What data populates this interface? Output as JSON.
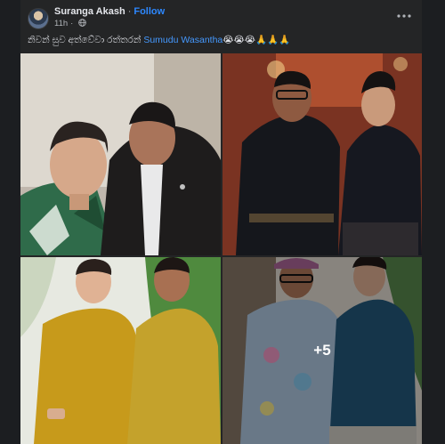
{
  "post": {
    "author": "Suranga Akash",
    "separator": "·",
    "follow_label": "Follow",
    "timestamp": "11h",
    "privacy_icon": "globe-icon",
    "more_icon": "more-options-icon",
    "caption_text": "නිවන් සුව අත්වේවා රත්තරන් ",
    "mention": "Sumudu Wasantha",
    "caption_emojis": "😭😭😭🙏🙏🙏"
  },
  "gallery": {
    "extra_count_label": "+5"
  },
  "colors": {
    "page_bg": "#1c1e21",
    "card_bg": "#242526",
    "text_primary": "#e4e6eb",
    "text_secondary": "#b0b3b8",
    "link_blue": "#2d88ff",
    "mention_blue": "#4599ff"
  }
}
